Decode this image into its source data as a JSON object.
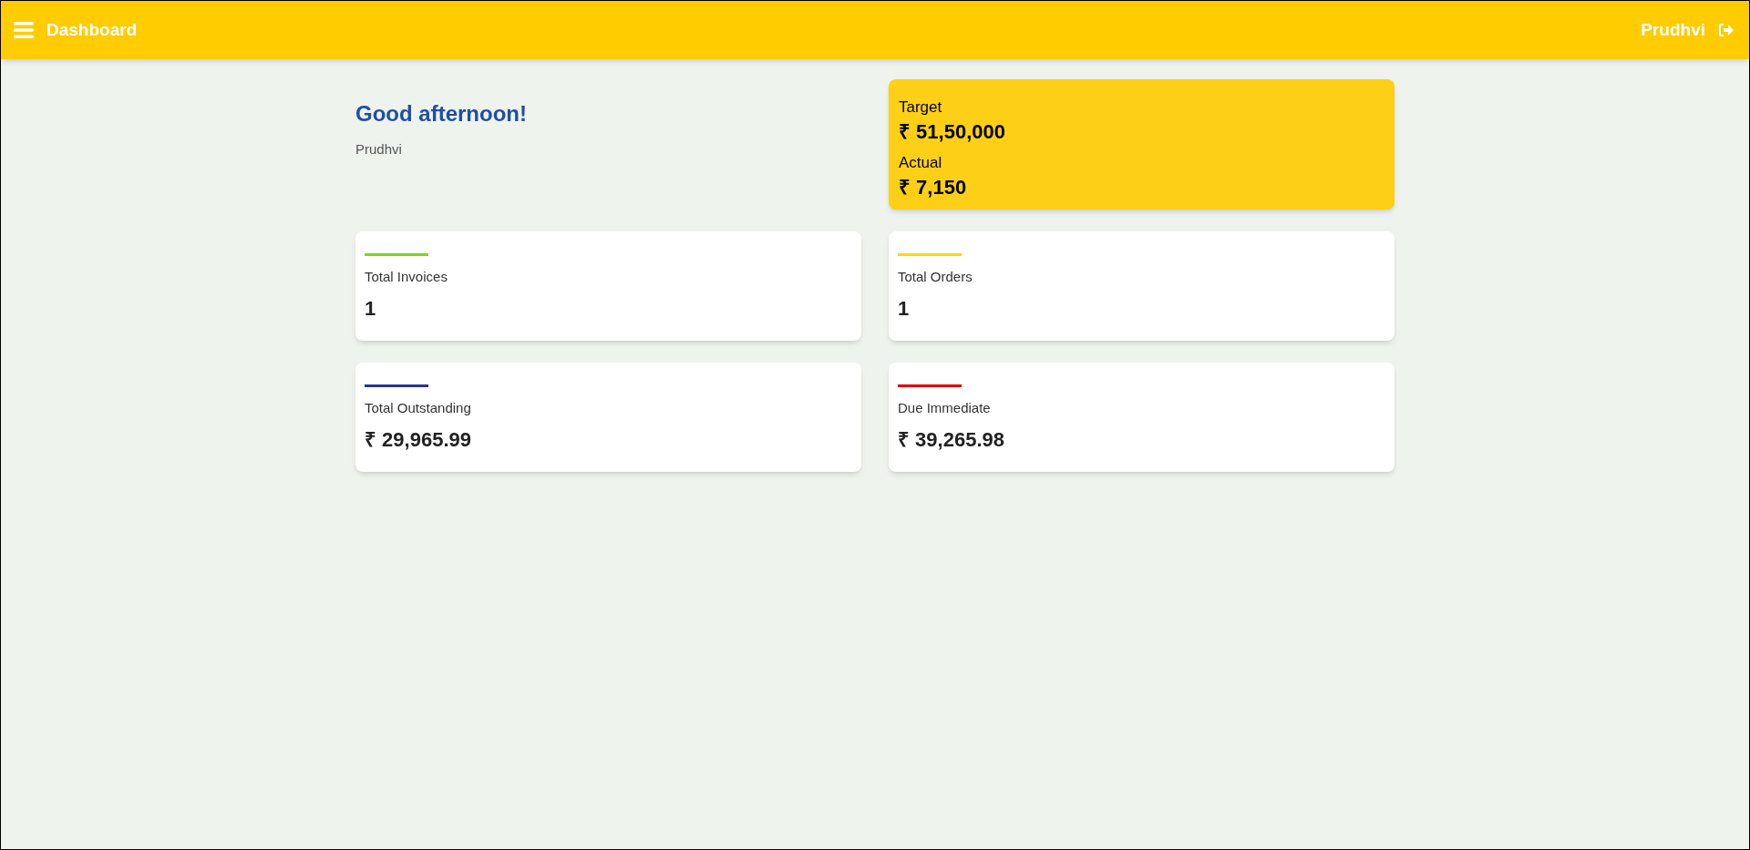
{
  "header": {
    "title": "Dashboard",
    "user": "Prudhvi"
  },
  "greeting": {
    "title": "Good afternoon!",
    "name": "Prudhvi"
  },
  "target_card": {
    "target_label": "Target",
    "target_value": "₹ 51,50,000",
    "actual_label": "Actual",
    "actual_value": "₹ 7,150"
  },
  "stats": [
    {
      "label": "Total Invoices",
      "value": "1",
      "color": "#7ed321"
    },
    {
      "label": "Total Orders",
      "value": "1",
      "color": "#ffd600"
    },
    {
      "label": "Total Outstanding",
      "value": "₹ 29,965.99",
      "color": "#283593"
    },
    {
      "label": "Due Immediate",
      "value": "₹ 39,265.98",
      "color": "#e00000"
    }
  ]
}
